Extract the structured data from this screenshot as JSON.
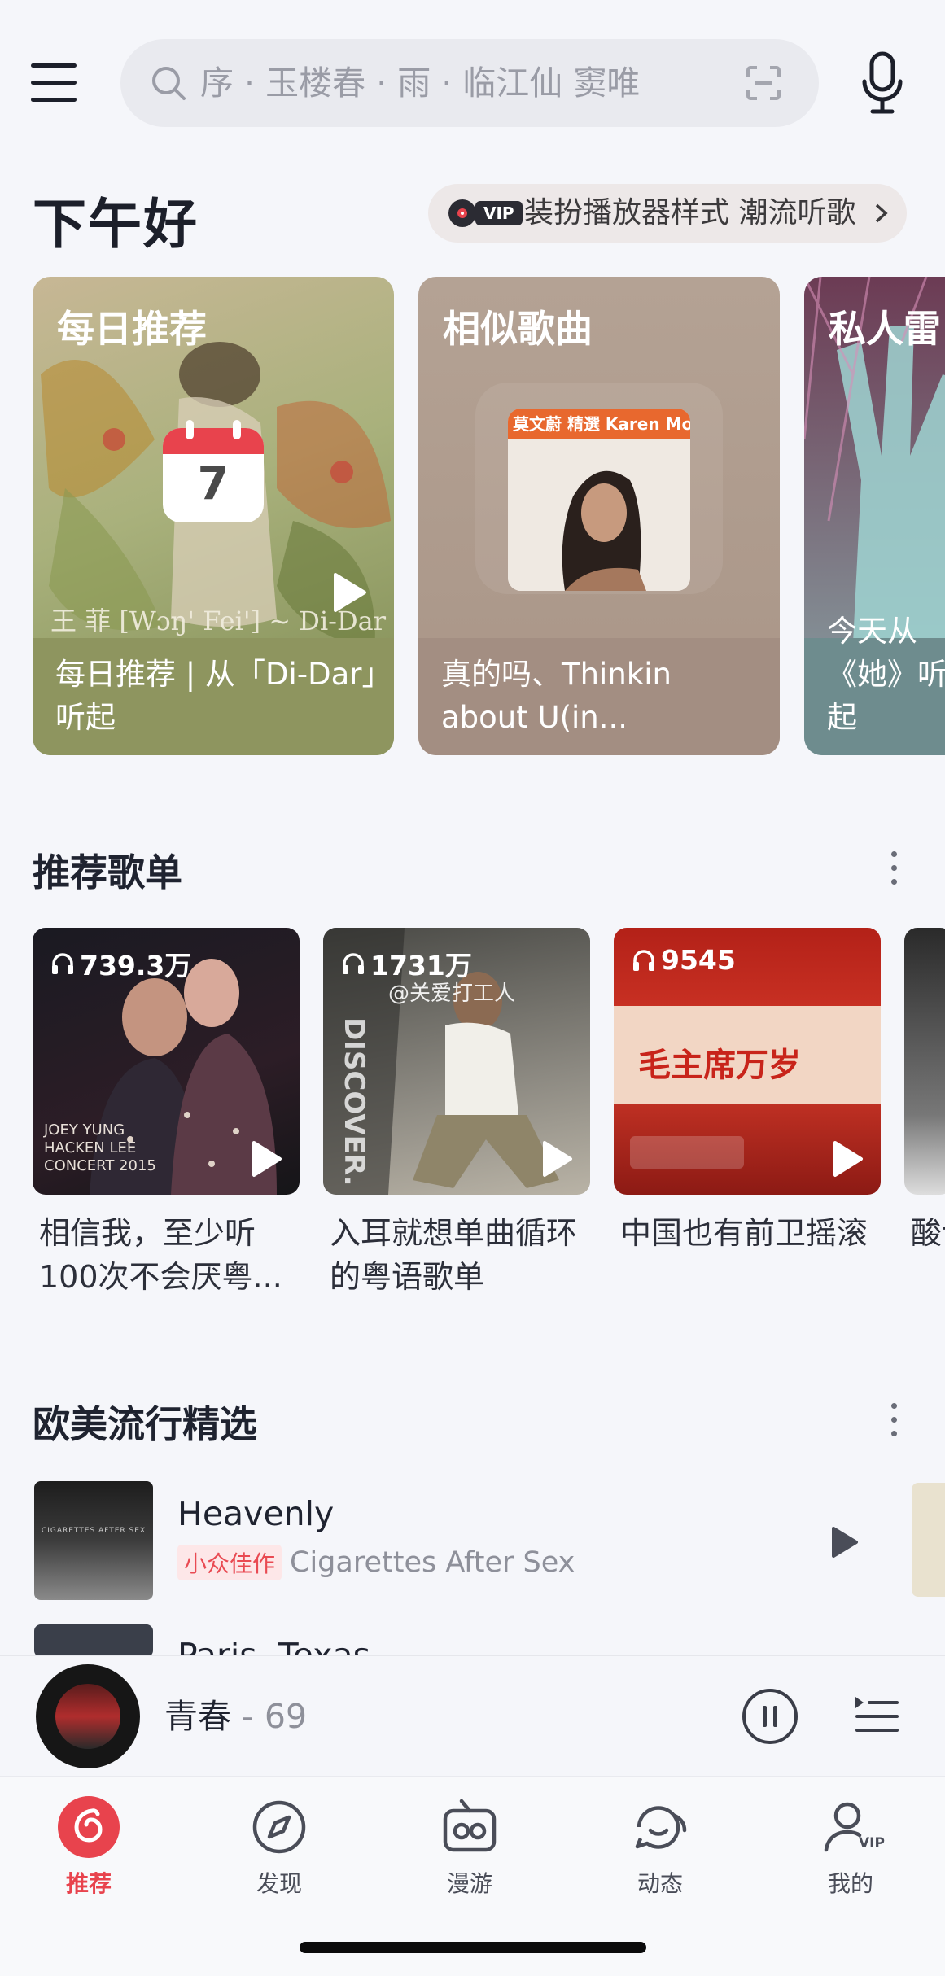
{
  "search": {
    "placeholder": "序 · 玉楼春 · 雨 · 临江仙 窦唯"
  },
  "greeting": "下午好",
  "vip_promo": {
    "badge": "VIP",
    "text": "装扮播放器样式 潮流听歌"
  },
  "feature_cards": [
    {
      "title": "每日推荐",
      "date_number": "7",
      "cover_text": "王 菲 [Wɔŋ' Fei'] ~ Di-Dar",
      "desc": "每日推荐 | 从「Di-Dar」听起"
    },
    {
      "title": "相似歌曲",
      "cover_header": "莫文蔚 精選 Karen Mok",
      "desc": "真的吗、Thinkin about U(in..."
    },
    {
      "title": "私人雷",
      "desc": "今天从《她》听起"
    }
  ],
  "playlists_section": {
    "title": "推荐歌单",
    "items": [
      {
        "count": "739.3万",
        "name": "相信我，至少听100次不会厌粤...",
        "cover_text": "JOEY YUNG HACKEN LEE CONCERT 2015"
      },
      {
        "count": "1731万",
        "name": "入耳就想单曲循环的粤语歌单",
        "cover_text": "DISCOVER.",
        "watermark": "@关爱打工人"
      },
      {
        "count": "9545",
        "name": "中国也有前卫摇滚",
        "cover_text": "毛主席万岁"
      },
      {
        "count": "",
        "name": "酸士"
      }
    ]
  },
  "western_section": {
    "title": "欧美流行精选",
    "songs": [
      {
        "title": "Heavenly",
        "tag": "小众佳作",
        "artist": "Cigarettes After Sex",
        "cover_text": "CIGARETTES AFTER SEX"
      },
      {
        "title": "Paris, Texas",
        "tag": "",
        "artist": ""
      }
    ]
  },
  "player": {
    "title": "青春",
    "artist": "69"
  },
  "nav": [
    {
      "label": "推荐",
      "active": true
    },
    {
      "label": "发现",
      "active": false
    },
    {
      "label": "漫游",
      "active": false
    },
    {
      "label": "动态",
      "active": false
    },
    {
      "label": "我的",
      "active": false
    }
  ],
  "nav_profile_badge": "VIP",
  "colors": {
    "accent": "#e8434d",
    "background": "#f5f6fa",
    "text": "#1f2330"
  }
}
